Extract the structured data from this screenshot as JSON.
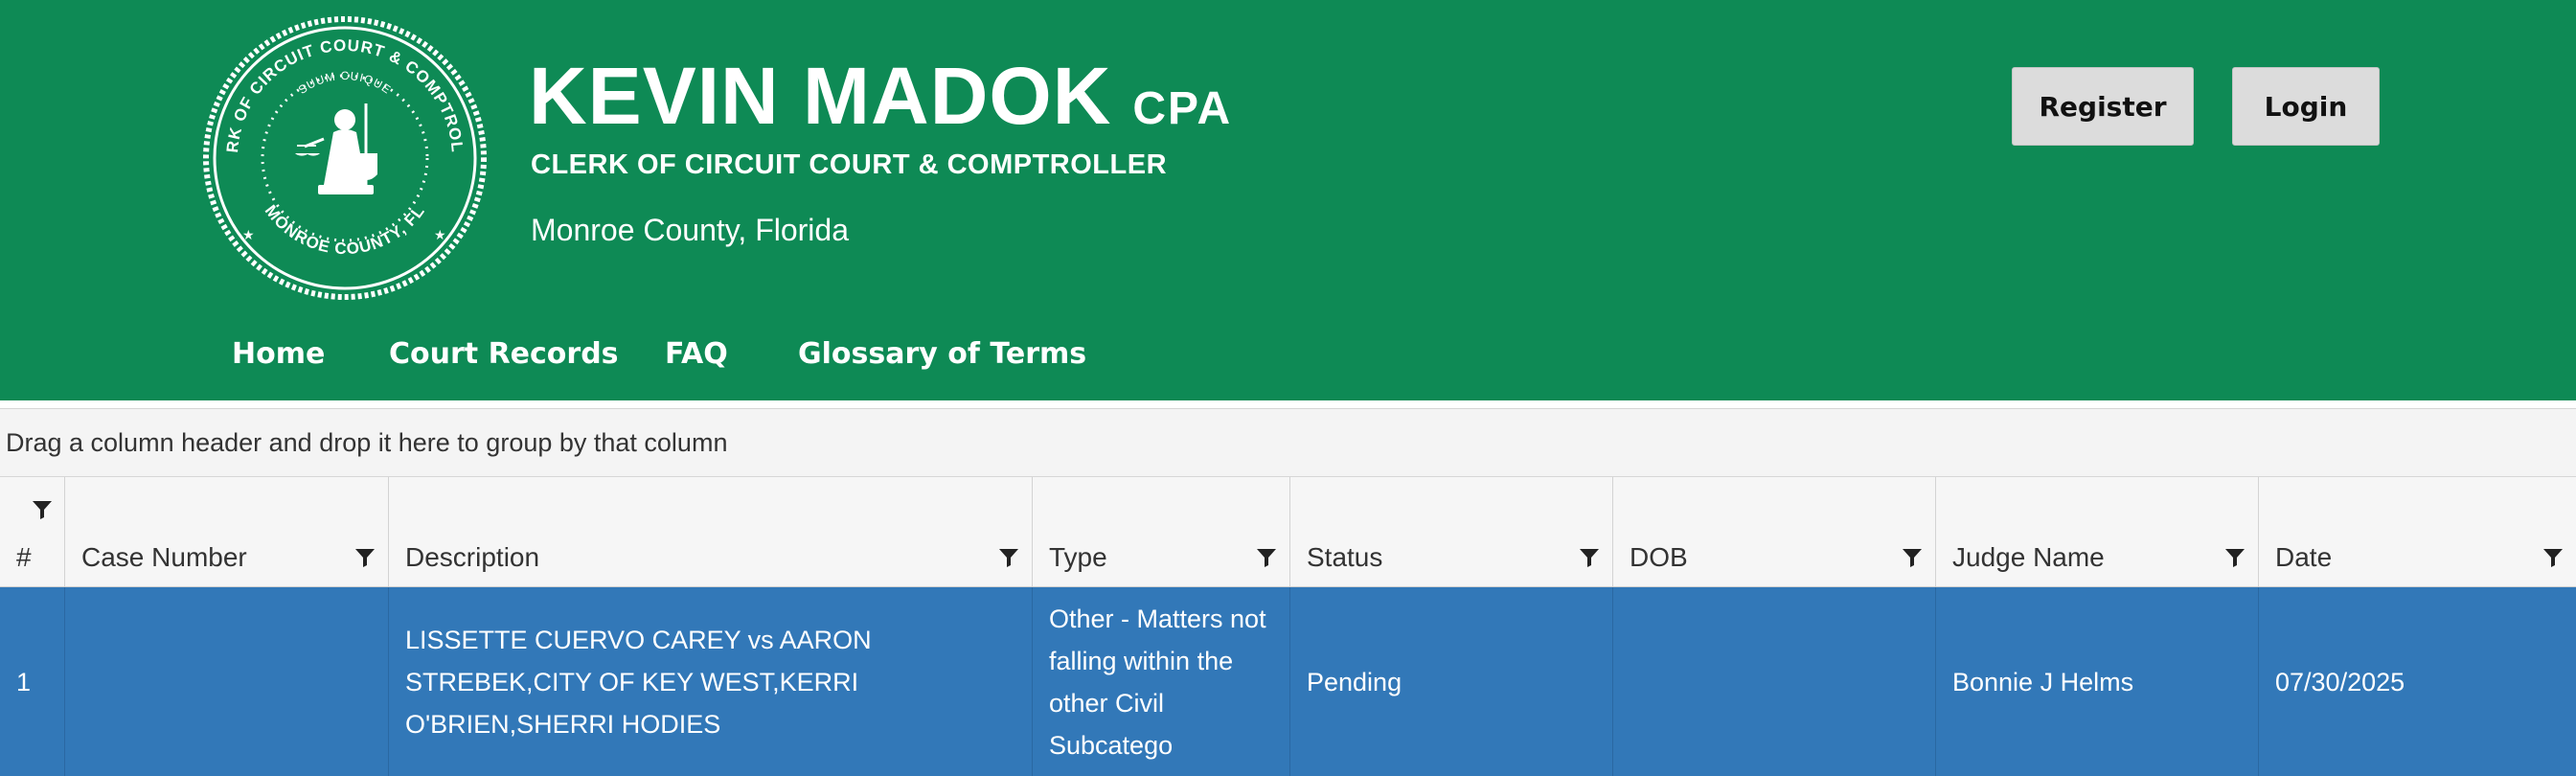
{
  "header": {
    "seal": {
      "ring_text": "CLERK OF CIRCUIT COURT & COMPTROLLER",
      "motto": "SUUM CUIQUE",
      "bottom_text": "MONROE COUNTY, FL"
    },
    "name": "KEVIN MADOK",
    "name_suffix": "CPA",
    "subtitle": "CLERK OF CIRCUIT COURT & COMPTROLLER",
    "county": "Monroe County, Florida",
    "buttons": {
      "register": "Register",
      "login": "Login"
    },
    "nav": [
      {
        "label": "Home"
      },
      {
        "label": "Court Records"
      },
      {
        "label": "FAQ"
      },
      {
        "label": "Glossary of Terms"
      }
    ],
    "colors": {
      "header_bg": "#0e8a55",
      "selected_row_bg": "#3278b8"
    }
  },
  "grid": {
    "group_hint": "Drag a column header and drop it here to group by that column",
    "columns": [
      {
        "label": "#"
      },
      {
        "label": "Case Number"
      },
      {
        "label": "Description"
      },
      {
        "label": "Type"
      },
      {
        "label": "Status"
      },
      {
        "label": "DOB"
      },
      {
        "label": "Judge Name"
      },
      {
        "label": "Date"
      }
    ],
    "rows": [
      {
        "index": "1",
        "case_number": "",
        "description": "LISSETTE CUERVO CAREY vs AARON STREBEK,CITY OF KEY WEST,KERRI O'BRIEN,SHERRI HODIES",
        "type": "Other - Matters not falling within the other Civil Subcatego",
        "status": "Pending",
        "dob": "",
        "judge_name": "Bonnie J Helms",
        "date": "07/30/2025"
      }
    ],
    "filter_icon": "funnel-icon"
  }
}
